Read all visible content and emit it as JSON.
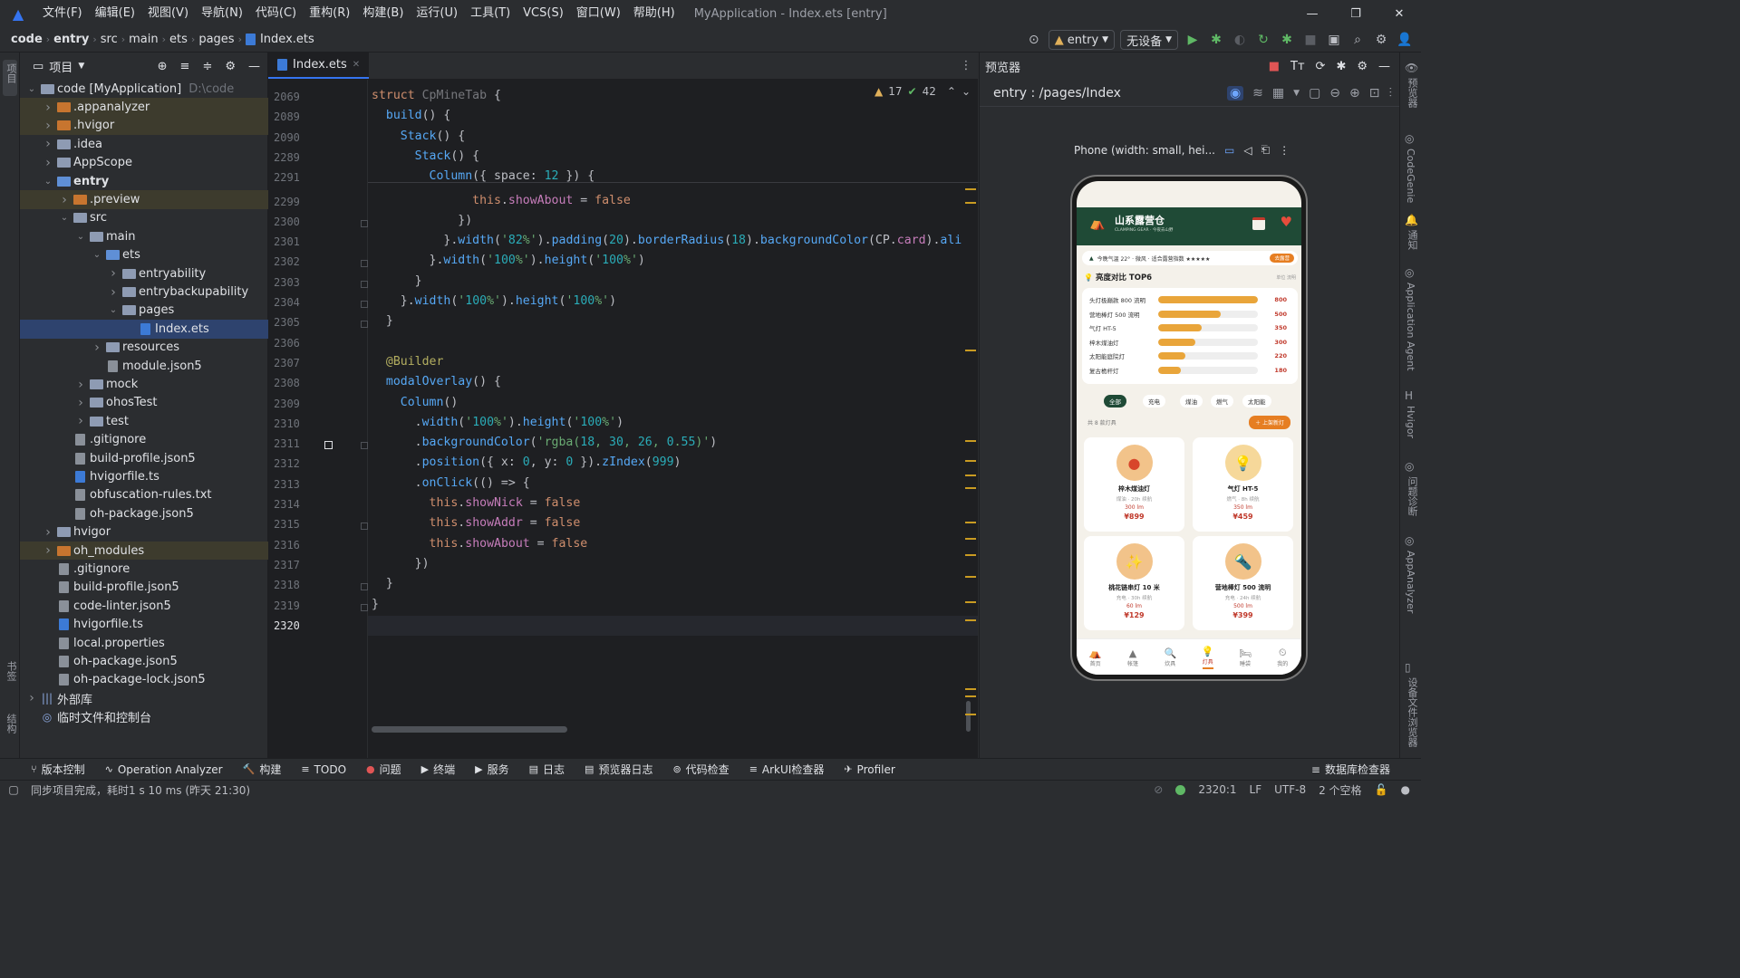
{
  "menu": [
    "文件(F)",
    "编辑(E)",
    "视图(V)",
    "导航(N)",
    "代码(C)",
    "重构(R)",
    "构建(B)",
    "运行(U)",
    "工具(T)",
    "VCS(S)",
    "窗口(W)",
    "帮助(H)"
  ],
  "window_title": "MyApplication - Index.ets [entry]",
  "breadcrumb": [
    "code",
    "entry",
    "src",
    "main",
    "ets",
    "pages",
    "Index.ets"
  ],
  "run": {
    "config": "entry",
    "device": "无设备"
  },
  "project": {
    "title": "项目",
    "tree": [
      {
        "label": "code [MyApplication]",
        "extra": "D:\\code",
        "depth": 0,
        "arrow": "v",
        "icon": "folder"
      },
      {
        "label": ".appanalyzer",
        "depth": 1,
        "arrow": ">",
        "icon": "folder-orange",
        "excl": true
      },
      {
        "label": ".hvigor",
        "depth": 1,
        "arrow": ">",
        "icon": "folder-orange",
        "excl": true
      },
      {
        "label": ".idea",
        "depth": 1,
        "arrow": ">",
        "icon": "folder"
      },
      {
        "label": "AppScope",
        "depth": 1,
        "arrow": ">",
        "icon": "folder"
      },
      {
        "label": "entry",
        "depth": 1,
        "arrow": "v",
        "icon": "folder-blue",
        "bold": true
      },
      {
        "label": ".preview",
        "depth": 2,
        "arrow": ">",
        "icon": "folder-orange",
        "excl": true
      },
      {
        "label": "src",
        "depth": 2,
        "arrow": "v",
        "icon": "folder"
      },
      {
        "label": "main",
        "depth": 3,
        "arrow": "v",
        "icon": "folder"
      },
      {
        "label": "ets",
        "depth": 4,
        "arrow": "v",
        "icon": "folder-blue"
      },
      {
        "label": "entryability",
        "depth": 5,
        "arrow": ">",
        "icon": "folder"
      },
      {
        "label": "entrybackupability",
        "depth": 5,
        "arrow": ">",
        "icon": "folder"
      },
      {
        "label": "pages",
        "depth": 5,
        "arrow": "v",
        "icon": "folder"
      },
      {
        "label": "Index.ets",
        "depth": 6,
        "arrow": "",
        "icon": "file-ts",
        "sel": true
      },
      {
        "label": "resources",
        "depth": 4,
        "arrow": ">",
        "icon": "folder"
      },
      {
        "label": "module.json5",
        "depth": 4,
        "arrow": "",
        "icon": "file"
      },
      {
        "label": "mock",
        "depth": 3,
        "arrow": ">",
        "icon": "folder"
      },
      {
        "label": "ohosTest",
        "depth": 3,
        "arrow": ">",
        "icon": "folder"
      },
      {
        "label": "test",
        "depth": 3,
        "arrow": ">",
        "icon": "folder"
      },
      {
        "label": ".gitignore",
        "depth": 2,
        "arrow": "",
        "icon": "file"
      },
      {
        "label": "build-profile.json5",
        "depth": 2,
        "arrow": "",
        "icon": "file"
      },
      {
        "label": "hvigorfile.ts",
        "depth": 2,
        "arrow": "",
        "icon": "file-ts"
      },
      {
        "label": "obfuscation-rules.txt",
        "depth": 2,
        "arrow": "",
        "icon": "file"
      },
      {
        "label": "oh-package.json5",
        "depth": 2,
        "arrow": "",
        "icon": "file"
      },
      {
        "label": "hvigor",
        "depth": 1,
        "arrow": ">",
        "icon": "folder"
      },
      {
        "label": "oh_modules",
        "depth": 1,
        "arrow": ">",
        "icon": "folder-orange",
        "excl": true
      },
      {
        "label": ".gitignore",
        "depth": 1,
        "arrow": "",
        "icon": "file"
      },
      {
        "label": "build-profile.json5",
        "depth": 1,
        "arrow": "",
        "icon": "file"
      },
      {
        "label": "code-linter.json5",
        "depth": 1,
        "arrow": "",
        "icon": "file"
      },
      {
        "label": "hvigorfile.ts",
        "depth": 1,
        "arrow": "",
        "icon": "file-ts"
      },
      {
        "label": "local.properties",
        "depth": 1,
        "arrow": "",
        "icon": "file"
      },
      {
        "label": "oh-package.json5",
        "depth": 1,
        "arrow": "",
        "icon": "file"
      },
      {
        "label": "oh-package-lock.json5",
        "depth": 1,
        "arrow": "",
        "icon": "file"
      },
      {
        "label": "外部库",
        "depth": 0,
        "arrow": ">",
        "icon": "lib"
      },
      {
        "label": "临时文件和控制台",
        "depth": 0,
        "arrow": "",
        "icon": "temp"
      }
    ]
  },
  "editor": {
    "tab": "Index.ets",
    "inspections": {
      "warnings": "17",
      "weak": "42"
    },
    "lines": [
      {
        "n": "2069",
        "c": "struct CpMineTab {"
      },
      {
        "n": "2089",
        "c": "  build() {"
      },
      {
        "n": "2090",
        "c": "    Stack() {"
      },
      {
        "n": "2289",
        "c": "      Stack() {"
      },
      {
        "n": "2291",
        "c": "        Column({ space: 12 }) {"
      },
      {
        "n": "2299",
        "c": "              this.showAbout = false"
      },
      {
        "n": "2300",
        "c": "            })"
      },
      {
        "n": "2301",
        "c": "          }.width('82%').padding(20).borderRadius(18).backgroundColor(CP.card).ali"
      },
      {
        "n": "2302",
        "c": "        }.width('100%').height('100%')"
      },
      {
        "n": "2303",
        "c": "      }"
      },
      {
        "n": "2304",
        "c": "    }.width('100%').height('100%')"
      },
      {
        "n": "2305",
        "c": "  }"
      },
      {
        "n": "2306",
        "c": ""
      },
      {
        "n": "2307",
        "c": "  @Builder"
      },
      {
        "n": "2308",
        "c": "  modalOverlay() {"
      },
      {
        "n": "2309",
        "c": "    Column()"
      },
      {
        "n": "2310",
        "c": "      .width('100%').height('100%')"
      },
      {
        "n": "2311",
        "c": "      .backgroundColor('rgba(18, 30, 26, 0.55)')"
      },
      {
        "n": "2312",
        "c": "      .position({ x: 0, y: 0 }).zIndex(999)"
      },
      {
        "n": "2313",
        "c": "      .onClick(() => {"
      },
      {
        "n": "2314",
        "c": "        this.showNick = false"
      },
      {
        "n": "2315",
        "c": "        this.showAddr = false"
      },
      {
        "n": "2316",
        "c": "        this.showAbout = false"
      },
      {
        "n": "2317",
        "c": "      })"
      },
      {
        "n": "2318",
        "c": "  }"
      },
      {
        "n": "2319",
        "c": "}"
      },
      {
        "n": "2320",
        "c": ""
      }
    ]
  },
  "preview": {
    "title": "预览器",
    "route": "entry : /pages/Index",
    "device": "Phone (width: small, hei..."
  },
  "app": {
    "name": "山系露营仓",
    "slogan": "CLAMPING GEAR · 今夜去山野",
    "banner": "今晚气温 22° · 微风 · 适合露营指数 ★★★★★",
    "banner_tag": "去露营",
    "section_title": "亮度对比 TOP6",
    "section_right": "单位 流明",
    "bars": [
      {
        "label": "头灯极巅款 800 流明",
        "value": 800
      },
      {
        "label": "营地棒灯 500 流明",
        "value": 500
      },
      {
        "label": "气灯 HT-5",
        "value": 350
      },
      {
        "label": "梓木煤油灯",
        "value": 300
      },
      {
        "label": "太阳能庭院灯",
        "value": 220
      },
      {
        "label": "复古桅杆灯",
        "value": 180
      }
    ],
    "bar_max": 800,
    "chips": [
      "全部",
      "充电",
      "煤油",
      "燃气",
      "太阳能"
    ],
    "count": "共 8 款灯具",
    "add_btn": "＋ 上架新灯",
    "products": [
      {
        "name": "梓木煤油灯",
        "sub": "煤油 · 20h 续航",
        "lm": "300 lm",
        "price": "¥899",
        "icon": "●"
      },
      {
        "name": "气灯 HT-5",
        "sub": "燃气 · 8h 续航",
        "lm": "350 lm",
        "price": "¥459",
        "icon": "💡"
      },
      {
        "name": "桃花链串灯 10 米",
        "sub": "充电 · 30h 续航",
        "lm": "60 lm",
        "price": "¥129",
        "icon": "✨"
      },
      {
        "name": "营地棒灯 500 流明",
        "sub": "充电 · 24h 续航",
        "lm": "500 lm",
        "price": "¥399",
        "icon": "🔦"
      }
    ],
    "nav": [
      "首页",
      "帐篷",
      "炊具",
      "灯具",
      "睡袋",
      "我的"
    ]
  },
  "bottom_tools": [
    "版本控制",
    "Operation Analyzer",
    "构建",
    "TODO",
    "问题",
    "终端",
    "服务",
    "日志",
    "预览器日志",
    "代码检查",
    "ArkUI检查器",
    "Profiler"
  ],
  "db_inspector": "数据库检查器",
  "status": {
    "message": "同步项目完成，耗时1 s 10 ms (昨天 21:30)",
    "position": "2320:1",
    "lf": "LF",
    "encoding": "UTF-8",
    "indent": "2 个空格"
  },
  "left_strip": [
    "项目",
    "书签",
    "结构"
  ],
  "right_strip": [
    "预览器",
    "CodeGenie",
    "通知",
    "Application Agent",
    "Hvigor",
    "问题诊断",
    "AppAnalyzer",
    "设备文件浏览器"
  ]
}
